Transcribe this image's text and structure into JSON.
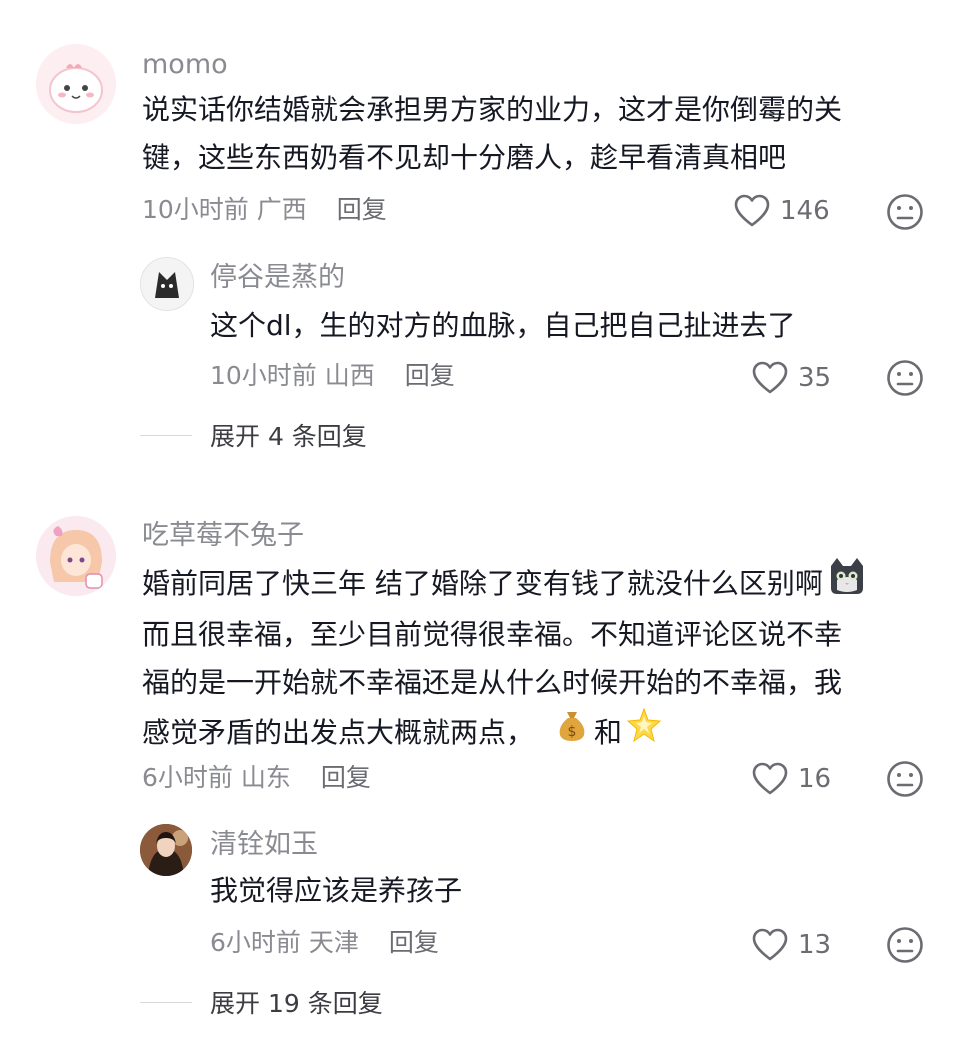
{
  "comments": [
    {
      "user": "momo",
      "lines": [
        "说实话你结婚就会承担男方家的业力，这才是你倒霉的关",
        "键，这些东西奶看不见却十分磨人，趁早看清真相吧"
      ],
      "time": "10小时前",
      "location": "广西",
      "reply": "回复",
      "likes": "146",
      "replies": [
        {
          "user": "停谷是蒸的",
          "lines": [
            "这个dl，生的对方的血脉，自己把自己扯进去了"
          ],
          "time": "10小时前",
          "location": "山西",
          "reply": "回复",
          "likes": "35"
        }
      ],
      "expand": "展开 4 条回复"
    },
    {
      "user": "吃草莓不兔子",
      "lines": [
        "婚前同居了快三年 结了婚除了变有钱了就没什么区别啊",
        "而且很幸福，至少目前觉得很幸福。不知道评论区说不幸",
        "福的是一开始就不幸福还是从什么时候开始的不幸福，我",
        "感觉矛盾的出发点大概就两点，"
      ],
      "inline_word": "和",
      "time": "6小时前",
      "location": "山东",
      "reply": "回复",
      "likes": "16",
      "replies": [
        {
          "user": "清铨如玉",
          "lines": [
            "我觉得应该是养孩子"
          ],
          "time": "6小时前",
          "location": "天津",
          "reply": "回复",
          "likes": "13"
        }
      ],
      "expand": "展开 19 条回复"
    }
  ],
  "icons": {
    "like": "heart-outline-icon",
    "dislike": "meh-face-icon",
    "emoji_1": "cat-face-emoji",
    "emoji_2": "money-bag-emoji",
    "emoji_3": "glowing-star-emoji"
  },
  "colors": {
    "text": "#161823",
    "muted": "#8a8b91",
    "icon": "#6b6c72"
  }
}
